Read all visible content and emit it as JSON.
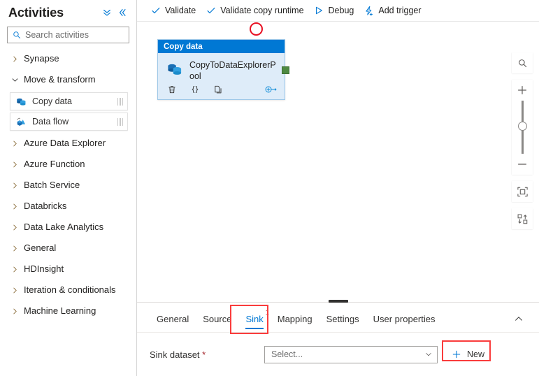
{
  "sidebar": {
    "title": "Activities",
    "header_icons": [
      {
        "name": "collapse-all-icon",
        "glyph": "chevron-double-down"
      },
      {
        "name": "collapse-panel-icon",
        "glyph": "chevron-double-left"
      }
    ],
    "search": {
      "placeholder": "Search activities",
      "value": "",
      "icon": "search-icon"
    },
    "groups": [
      {
        "label": "Synapse",
        "expanded": false
      },
      {
        "label": "Move & transform",
        "expanded": true
      },
      {
        "label": "Azure Data Explorer",
        "expanded": false
      },
      {
        "label": "Azure Function",
        "expanded": false
      },
      {
        "label": "Batch Service",
        "expanded": false
      },
      {
        "label": "Databricks",
        "expanded": false
      },
      {
        "label": "Data Lake Analytics",
        "expanded": false
      },
      {
        "label": "General",
        "expanded": false
      },
      {
        "label": "HDInsight",
        "expanded": false
      },
      {
        "label": "Iteration & conditionals",
        "expanded": false
      },
      {
        "label": "Machine Learning",
        "expanded": false
      }
    ],
    "activities": [
      {
        "label": "Copy data",
        "icon": "copy-data-icon"
      },
      {
        "label": "Data flow",
        "icon": "data-flow-icon"
      }
    ]
  },
  "toolbar": {
    "buttons": [
      {
        "label": "Validate",
        "icon": "check-icon"
      },
      {
        "label": "Validate copy runtime",
        "icon": "check-icon"
      },
      {
        "label": "Debug",
        "icon": "play-icon"
      },
      {
        "label": "Add trigger",
        "icon": "lightning-plus-icon"
      }
    ]
  },
  "canvas": {
    "node": {
      "header": "Copy data",
      "name": "CopyToDataExplorerPool",
      "icon": "copy-data-icon",
      "actions": [
        {
          "name": "delete-activity-icon",
          "glyph": "trash"
        },
        {
          "name": "view-code-icon",
          "glyph": "braces"
        },
        {
          "name": "clone-activity-icon",
          "glyph": "copy"
        },
        {
          "name": "add-output-icon",
          "glyph": "arrow-circle-right"
        }
      ],
      "port": "output-port"
    },
    "annotation": {
      "shape": "circle",
      "color": "#e81123"
    },
    "tools": [
      {
        "name": "zoom-to-fit-search-icon",
        "glyph": "magnifier"
      },
      {
        "name": "zoom-in-icon",
        "glyph": "plus"
      },
      {
        "name": "zoom-slider",
        "glyph": "slider"
      },
      {
        "name": "zoom-out-icon",
        "glyph": "minus"
      },
      {
        "name": "fit-to-screen-icon",
        "glyph": "fit"
      },
      {
        "name": "auto-align-icon",
        "glyph": "align"
      }
    ]
  },
  "bottom": {
    "tabs": [
      {
        "label": "General",
        "active": false,
        "badge": ""
      },
      {
        "label": "Source",
        "active": false,
        "badge": ""
      },
      {
        "label": "Sink",
        "active": true,
        "badge": "1"
      },
      {
        "label": "Mapping",
        "active": false,
        "badge": ""
      },
      {
        "label": "Settings",
        "active": false,
        "badge": ""
      },
      {
        "label": "User properties",
        "active": false,
        "badge": ""
      }
    ],
    "collapse_icon": "chevron-up-icon",
    "form": {
      "label": "Sink dataset ",
      "required_mark": "*",
      "select_value": "Select...",
      "new_label": "New"
    }
  },
  "colors": {
    "accent": "#0078d4",
    "highlight": "#fa3c3c",
    "node_body": "#deecf9",
    "node_port": "#4f8a42",
    "required": "#a4262c"
  }
}
